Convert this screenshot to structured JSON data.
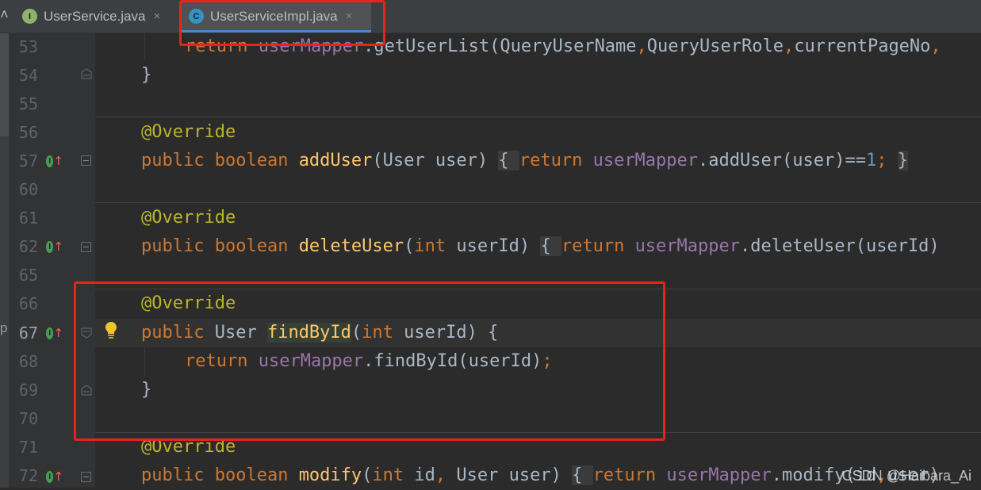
{
  "tabs": [
    {
      "icon": "I",
      "label": "UserService.java",
      "close": "×",
      "icon_color": "#8fb36a"
    },
    {
      "icon": "C",
      "label": "UserServiceImpl.java",
      "close": "×",
      "icon_color": "#3592c4"
    }
  ],
  "gutter": {
    "line_numbers": [
      "53",
      "54",
      "55",
      "56",
      "57",
      "60",
      "61",
      "62",
      "65",
      "66",
      "67",
      "68",
      "69",
      "70",
      "71",
      "72"
    ]
  },
  "override_marker": "I",
  "code": {
    "l53": {
      "kw": "return ",
      "field": "userMapper",
      "rest": ".getUserList(QueryUserName",
      "c1": ",",
      "a2": "QueryUserRole",
      "c2": ",",
      "a3": "currentPageNo",
      "c3": ","
    },
    "l54": "}",
    "l56": "@Override",
    "l57": {
      "mod": "public ",
      "type": "boolean ",
      "name": "addUser",
      "params": "(User user) ",
      "lb": "{ ",
      "ret": "return ",
      "field": "userMapper",
      "call": ".addUser(user)==",
      "num": "1",
      "semi": "; ",
      "rb": "}"
    },
    "l61": "@Override",
    "l62": {
      "mod": "public ",
      "type": "boolean ",
      "name": "deleteUser",
      "p_open": "(",
      "p_kw": "int ",
      "p_rest": "userId) ",
      "lb": "{ ",
      "ret": "return ",
      "field": "userMapper",
      "call": ".deleteUser(userId)"
    },
    "l66": "@Override",
    "l67": {
      "mod": "public ",
      "type": "User ",
      "name": "findById",
      "p_open": "(",
      "p_kw": "int ",
      "p_rest": "userId) {"
    },
    "l68": {
      "ret": "return ",
      "field": "userMapper",
      "call": ".findById(userId)",
      "semi": ";"
    },
    "l69": "}",
    "l71": "@Override",
    "l72": {
      "mod": "public ",
      "type": "boolean ",
      "name": "modify",
      "p_open": "(",
      "p_kw": "int ",
      "p_a": "id",
      "p_c": ", ",
      "p_b": "User user) ",
      "lb": "{ ",
      "ret": "return ",
      "field": "userMapper",
      "call": ".modify(id",
      "c": ",",
      "call2": "user)"
    }
  },
  "side_text": "p",
  "watermark": "CSDN @Haibara_Ai",
  "colors": {
    "keyword": "#cc7832",
    "annotation": "#bbb529",
    "method": "#ffc66d",
    "field": "#9876aa",
    "number": "#6897bb",
    "highlight": "#e8231e"
  }
}
